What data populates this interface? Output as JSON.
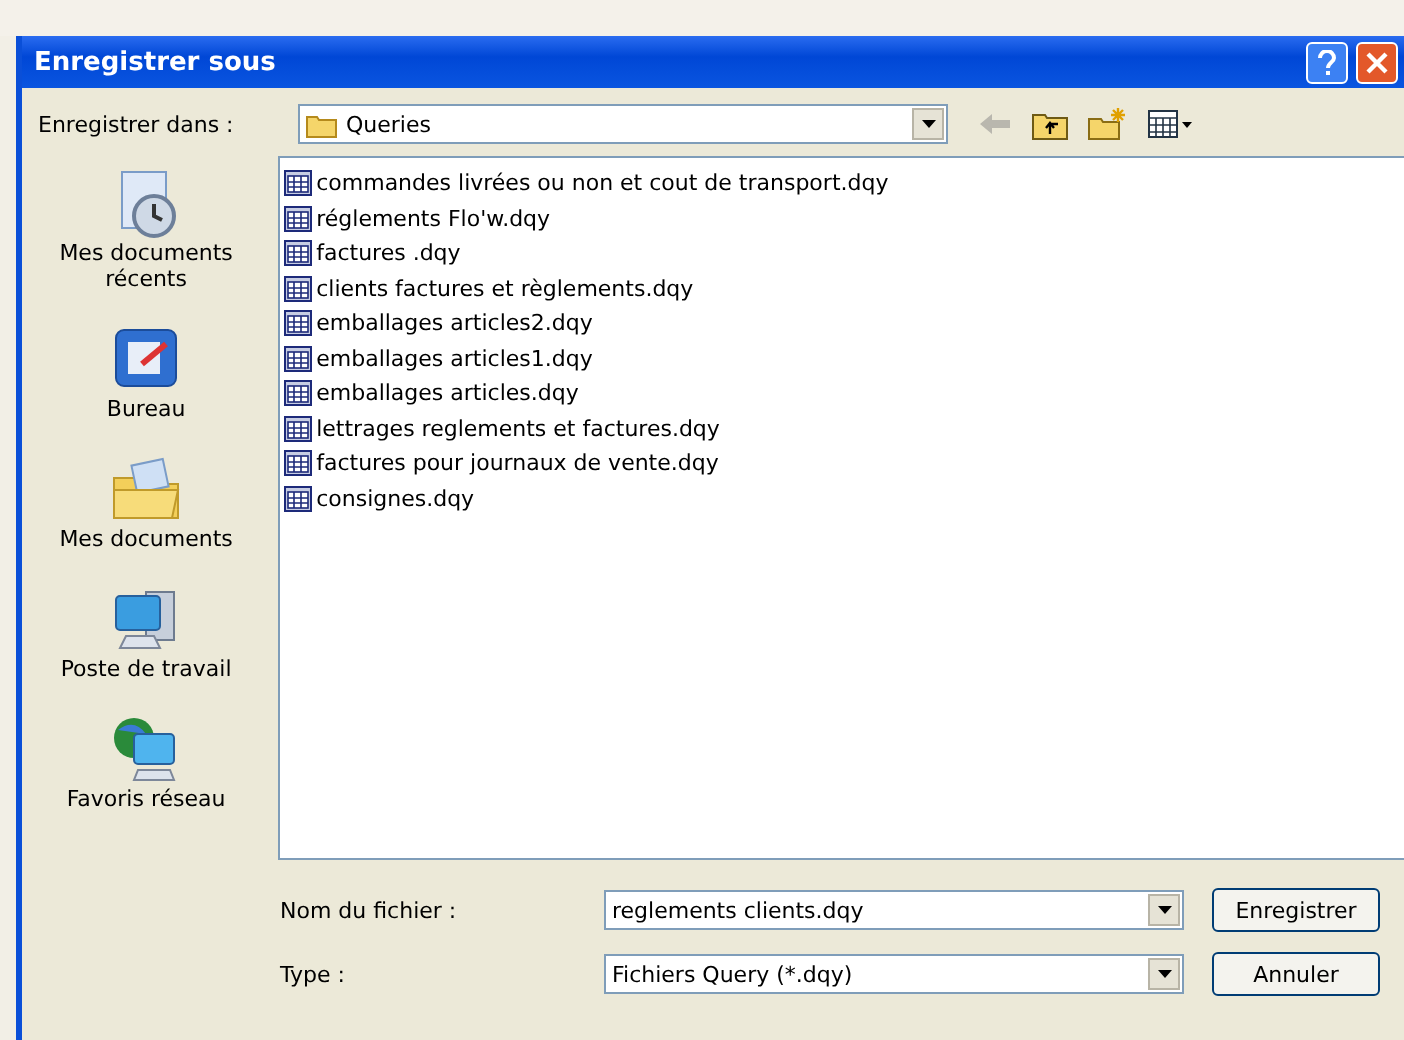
{
  "window": {
    "title": "Enregistrer sous"
  },
  "toolbar": {
    "label": "Enregistrer dans :",
    "location": "Queries"
  },
  "places": [
    {
      "kind": "recent",
      "label": "Mes documents récents"
    },
    {
      "kind": "desktop",
      "label": "Bureau"
    },
    {
      "kind": "documents",
      "label": "Mes documents"
    },
    {
      "kind": "computer",
      "label": "Poste de travail"
    },
    {
      "kind": "network",
      "label": "Favoris réseau"
    }
  ],
  "files": [
    "commandes livrées ou non et cout de transport.dqy",
    "réglements Flo'w.dqy",
    "factures .dqy",
    "clients factures et règlements.dqy",
    "emballages articles2.dqy",
    "emballages articles1.dqy",
    "emballages articles.dqy",
    "lettrages reglements et factures.dqy",
    "factures pour journaux de vente.dqy",
    "consignes.dqy"
  ],
  "filename": {
    "label": "Nom du fichier :",
    "value": "reglements clients.dqy"
  },
  "filetype": {
    "label": "Type :",
    "value": "Fichiers Query (*.dqy)"
  },
  "buttons": [
    "Enregistrer",
    "Annuler"
  ]
}
